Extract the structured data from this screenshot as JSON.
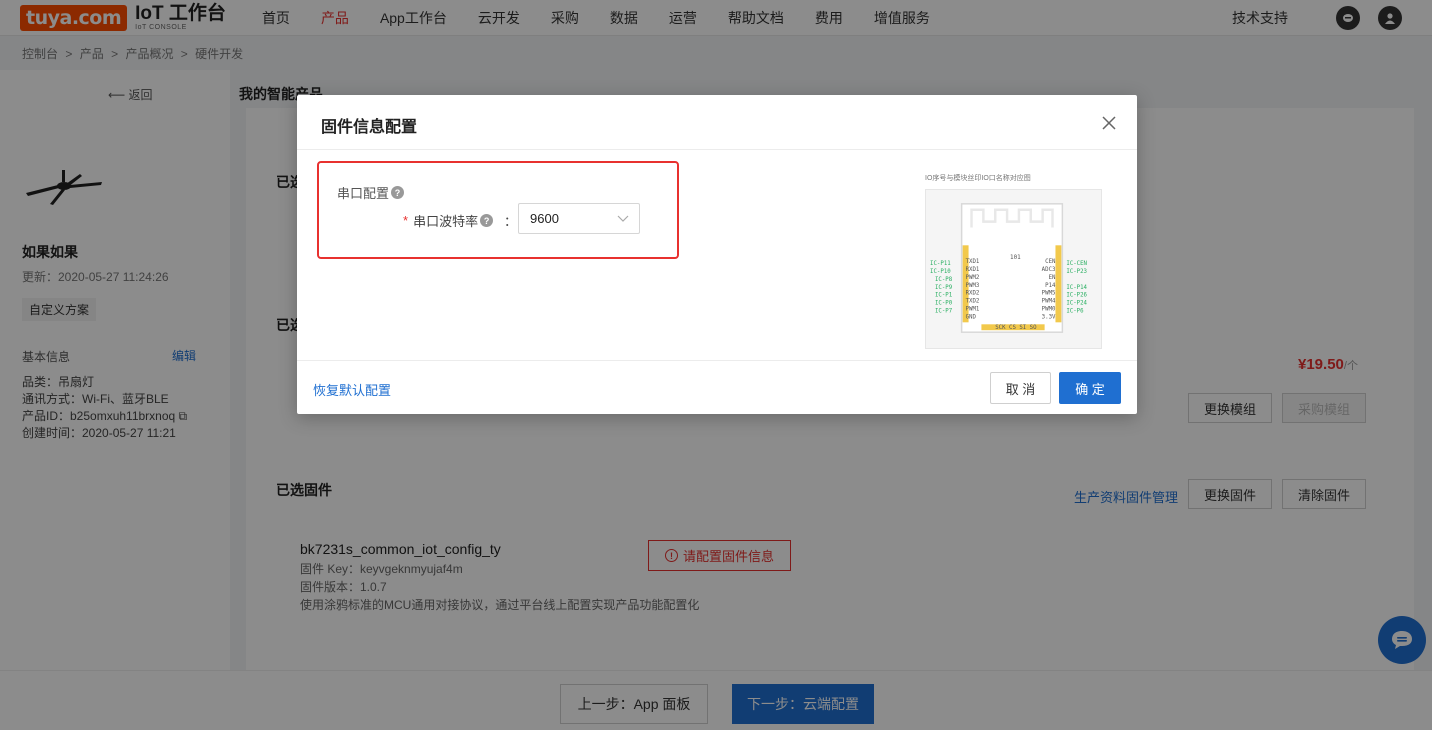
{
  "header": {
    "logo_brand": "tuya.com",
    "logo_title": "IoT 工作台",
    "logo_subtitle": "IoT CONSOLE",
    "nav": [
      "首页",
      "产品",
      "App工作台",
      "云开发",
      "采购",
      "数据",
      "运营",
      "帮助文档",
      "费用",
      "增值服务"
    ],
    "active_nav": "产品",
    "support": "技术支持"
  },
  "breadcrumb": [
    "控制台",
    ">",
    "产品",
    ">",
    "产品概况",
    ">",
    "硬件开发"
  ],
  "back": "返回",
  "page_title": "我的智能产品",
  "product": {
    "name": "如果如果",
    "updated": "更新：2020-05-27 11:24:26",
    "custom_plan": "自定义方案",
    "basic_info": "基本信息",
    "edit": "编辑",
    "category": "品类：吊扇灯",
    "comm": "通讯方式：Wi-Fi、蓝牙BLE",
    "pid": "产品ID：b25omxuh11brxnoq",
    "created": "创建时间：2020-05-27 11:21"
  },
  "main": {
    "section1": "已选",
    "section2": "已选",
    "price": "¥19.50",
    "price_unit": "/个",
    "change_module": "更换模组",
    "buy_module": "采购模组",
    "fw_section": "已选固件",
    "fw_manage": "生产资料固件管理",
    "change_fw": "更换固件",
    "clear_fw": "清除固件",
    "fw_name": "bk7231s_common_iot_config_ty",
    "fw_key": "固件 Key：keyvgeknmyujaf4m",
    "fw_version": "固件版本：1.0.7",
    "fw_desc": "使用涂鸦标准的MCU通用对接协议，通过平台线上配置实现产品功能配置化",
    "config_warn": "请配置固件信息",
    "prev_step": "上一步：App 面板",
    "next_step": "下一步：云端配置"
  },
  "modal": {
    "title": "固件信息配置",
    "section_label": "串口配置",
    "field_label": "串口波特率",
    "colon": "：",
    "baud_value": "9600",
    "diagram_caption": "IO序号与模块丝印IO口名称对应图",
    "restore": "恢复默认配置",
    "cancel": "取 消",
    "ok": "确 定"
  },
  "diagram": {
    "chip_id": "101",
    "left_io": [
      "IC-P11",
      "IC-P10",
      "IC-P8",
      "IC-P9",
      "IC-P1",
      "IC-P0",
      "IC-P7"
    ],
    "left_pins": [
      "TXD1",
      "RXD1",
      "PWM2",
      "PWM3",
      "RXD2",
      "TXD2",
      "PWM1",
      "GND"
    ],
    "right_pins": [
      "CEN",
      "ADC3",
      "EN",
      "P14",
      "PWM5",
      "PWM4",
      "PWM0",
      "3.3V"
    ],
    "right_io": [
      "IC-CEN",
      "IC-P23",
      "",
      "IC-P14",
      "IC-P26",
      "IC-P24",
      "IC-P6"
    ],
    "bottom_pins": "SCK CS  SI  SO"
  }
}
